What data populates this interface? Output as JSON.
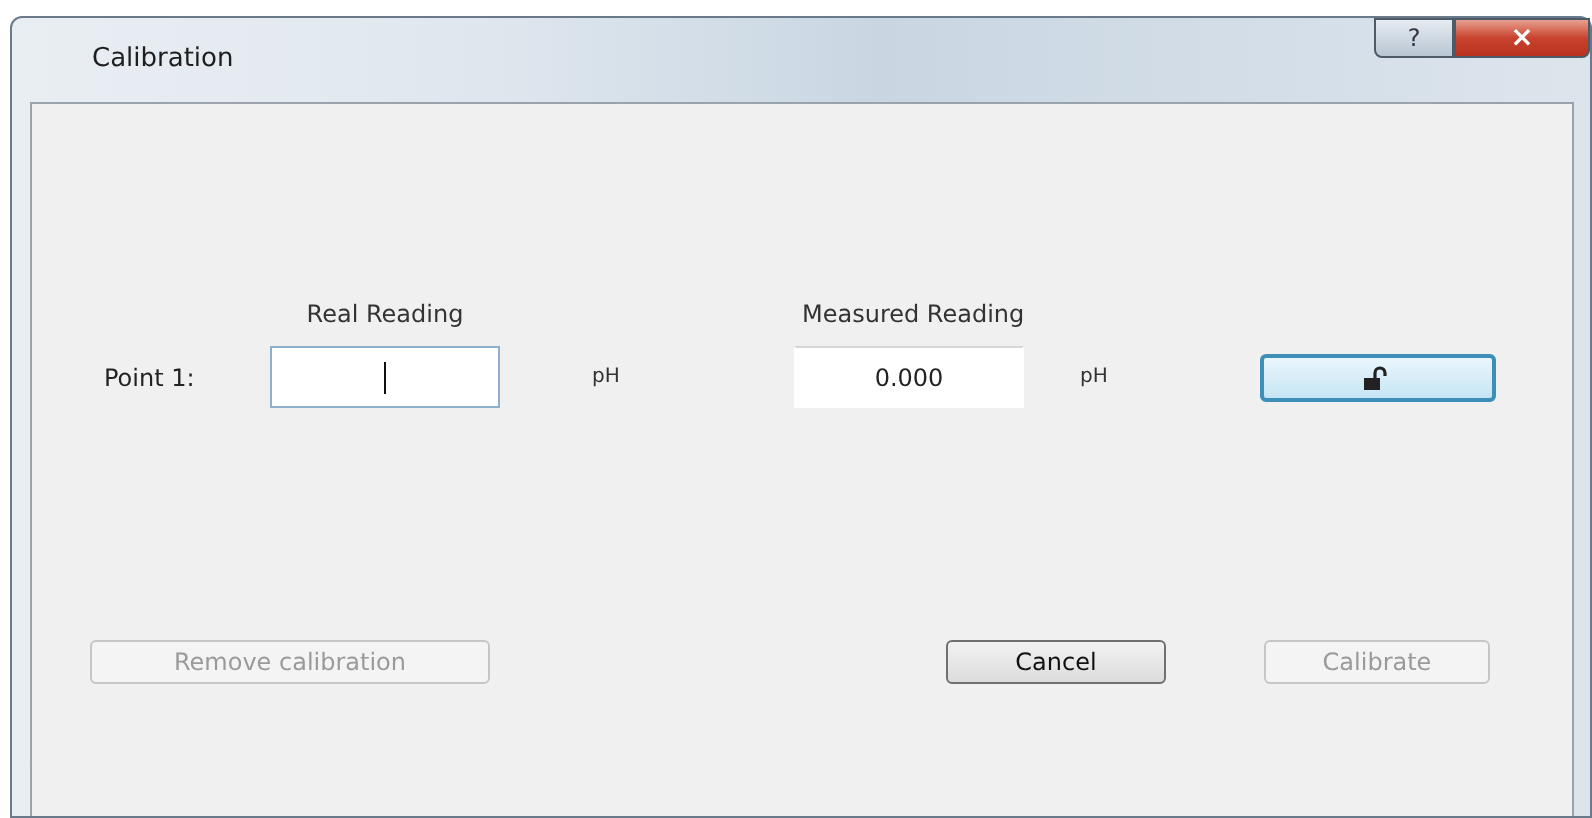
{
  "window": {
    "title": "Calibration",
    "help": "?",
    "close": "×"
  },
  "headings": [
    "Real Reading",
    "Measured Reading"
  ],
  "points": [
    {
      "label": "Point 1:",
      "real": {
        "focused": true
      },
      "real_unit": "pH",
      "measured": "0.000",
      "measured_unit": "pH",
      "locked": false
    }
  ],
  "buttons": [
    {
      "label": "Remove calibration",
      "disabled": true
    },
    {
      "label": "Cancel",
      "disabled": false
    },
    {
      "label": "Calibrate",
      "disabled": true
    }
  ]
}
